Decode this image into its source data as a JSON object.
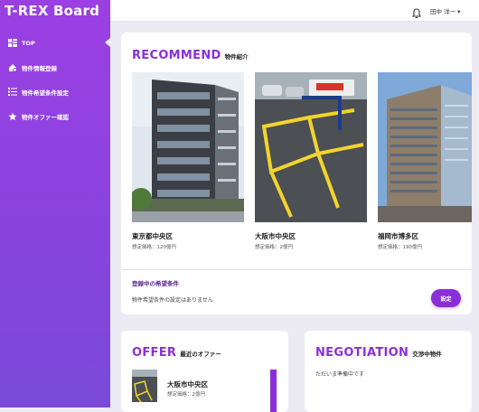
{
  "app": {
    "brand": "T-REX Board"
  },
  "sidebar": {
    "items": [
      {
        "label": "TOP",
        "icon": "dashboard-icon"
      },
      {
        "label": "物件情報登録",
        "icon": "add-property-icon"
      },
      {
        "label": "物件希望条件設定",
        "icon": "list-settings-icon"
      },
      {
        "label": "物件オファー確認",
        "icon": "star-icon"
      }
    ]
  },
  "header": {
    "user_name": "田中 洋一 ▾"
  },
  "recommend": {
    "title": "RECOMMEND",
    "subtitle": "物件紹介",
    "properties": [
      {
        "name": "東京都中央区",
        "price": "想定価格：120億円"
      },
      {
        "name": "大阪市中央区",
        "price": "想定価格：2億円"
      },
      {
        "name": "福岡市博多区",
        "price": "想定価格：190億円"
      }
    ],
    "condition_title": "登録中の希望条件",
    "condition_text": "物件希望条件の設定はありません",
    "set_button": "設定"
  },
  "offer": {
    "title": "OFFER",
    "subtitle": "最近のオファー",
    "items": [
      {
        "name": "大阪市中央区",
        "price": "想定価格：2億円"
      }
    ]
  },
  "negotiation": {
    "title": "NEGOTIATION",
    "subtitle": "交渉中物件",
    "empty_text": "ただいま準備中です"
  },
  "colors": {
    "accent": "#8a2ed8",
    "sidebar_top": "#9b3fe2",
    "sidebar_bottom": "#7a4bd8",
    "background": "#ecebf4"
  }
}
